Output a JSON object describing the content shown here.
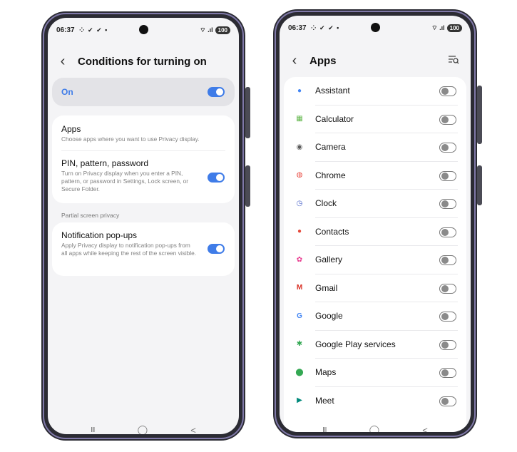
{
  "status_bar": {
    "time": "06:37",
    "notifications": "⁘ ✔ ✔ •",
    "signal": "⌔ .ıl",
    "battery": "100"
  },
  "left_screen": {
    "title": "Conditions for turning on",
    "master_toggle": {
      "label": "On",
      "state": "on"
    },
    "items": [
      {
        "title": "Apps",
        "desc": "Choose apps where you want to use Privacy display."
      },
      {
        "title": "PIN, pattern, password",
        "desc": "Turn on Privacy display when you enter a PIN, pattern, or password in Settings, Lock screen, or Secure Folder.",
        "toggle": "on"
      }
    ],
    "section_header": "Partial screen privacy",
    "notification_item": {
      "title": "Notification pop-ups",
      "desc": "Apply Privacy display to notification pop-ups from all apps while keeping the rest of the screen visible.",
      "toggle": "on"
    }
  },
  "right_screen": {
    "title": "Apps",
    "search_icon": "search-filter-icon",
    "apps": [
      {
        "name": "Assistant",
        "icon": "assistant-icon",
        "color": "#4285f4",
        "glyph": "●",
        "toggle": "off"
      },
      {
        "name": "Calculator",
        "icon": "calculator-icon",
        "color": "#5fb548",
        "glyph": "▦",
        "toggle": "off"
      },
      {
        "name": "Camera",
        "icon": "camera-icon",
        "color": "#5c5c5c",
        "glyph": "◉",
        "toggle": "off"
      },
      {
        "name": "Chrome",
        "icon": "chrome-icon",
        "color": "#e8453c",
        "glyph": "◍",
        "toggle": "off"
      },
      {
        "name": "Clock",
        "icon": "clock-icon",
        "color": "#4a63c9",
        "glyph": "◷",
        "toggle": "off"
      },
      {
        "name": "Contacts",
        "icon": "contacts-icon",
        "color": "#e5493a",
        "glyph": "●",
        "toggle": "off"
      },
      {
        "name": "Gallery",
        "icon": "gallery-icon",
        "color": "#e8388e",
        "glyph": "✿",
        "toggle": "off"
      },
      {
        "name": "Gmail",
        "icon": "gmail-icon",
        "color": "#d93025",
        "glyph": "M",
        "toggle": "off"
      },
      {
        "name": "Google",
        "icon": "google-icon",
        "color": "#4285f4",
        "glyph": "G",
        "toggle": "off"
      },
      {
        "name": "Google Play services",
        "icon": "google-play-services-icon",
        "color": "#34a853",
        "glyph": "✱",
        "toggle": "off"
      },
      {
        "name": "Maps",
        "icon": "maps-icon",
        "color": "#34a853",
        "glyph": "⬤",
        "toggle": "off"
      },
      {
        "name": "Meet",
        "icon": "meet-icon",
        "color": "#00897b",
        "glyph": "▶",
        "toggle": "off"
      }
    ]
  },
  "nav": {
    "recents": "III",
    "home": "◯",
    "back": "<"
  },
  "colors": {
    "accent": "#3f7ce8",
    "frame": "#2b2b33",
    "frame_accent": "#7f78a8"
  }
}
